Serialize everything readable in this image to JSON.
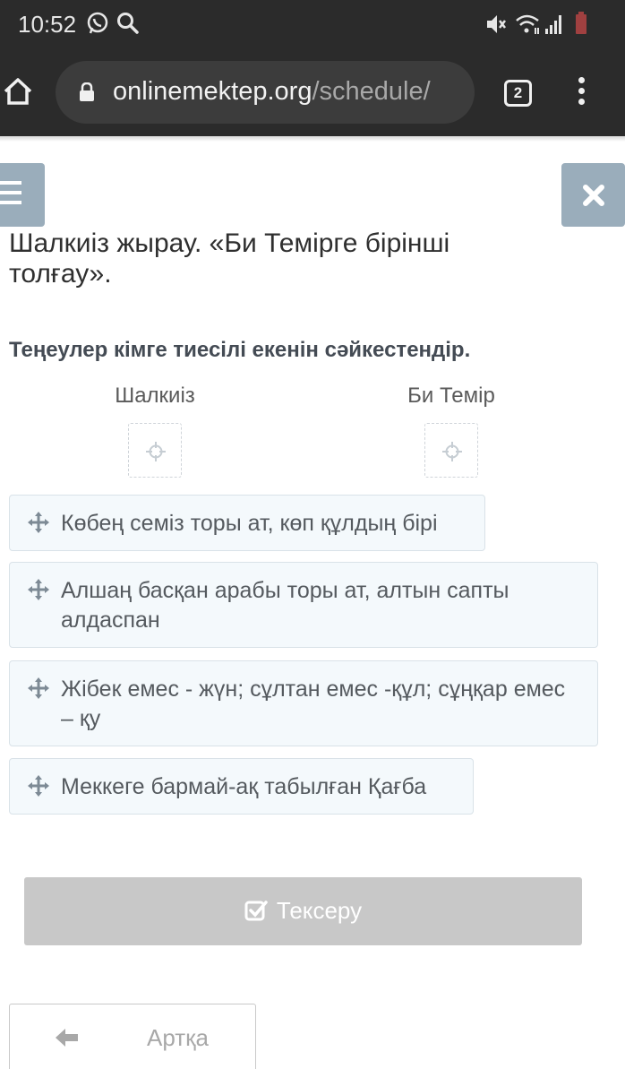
{
  "status_bar": {
    "time": "10:52",
    "icons": [
      "whatsapp-icon",
      "search-icon",
      "mute-icon",
      "wifi-icon",
      "signal-icon",
      "battery-icon"
    ]
  },
  "browser": {
    "url_host": "onlinemektep.org",
    "url_path": "/schedule/",
    "tab_count": "2"
  },
  "page": {
    "title": "Шалкиіз жырау. «Би Темірге бірінші толғау».",
    "question": "Теңеулер кімге тиесілі екенін сәйкестендір.",
    "targets": [
      {
        "label": "Шалкиіз"
      },
      {
        "label": "Би Темір"
      }
    ],
    "items": [
      {
        "text": "Көбең семіз торы ат, көп құлдың бірі"
      },
      {
        "text": "Алшаң басқан арабы торы ат, алтын сапты алдаспан"
      },
      {
        "text": "Жібек емес - жүн; сұлтан емес -құл; сұңқар емес – қу"
      },
      {
        "text": "Меккеге бармай-ақ табылған Қағба"
      }
    ],
    "check_label": "Тексеру",
    "back_label": "Артқа"
  },
  "colors": {
    "browser_bar": "#2b2b2b",
    "floating_button": "#9aadbb",
    "item_background": "#f4f9fc",
    "check_button_disabled": "#c8c8c8"
  }
}
